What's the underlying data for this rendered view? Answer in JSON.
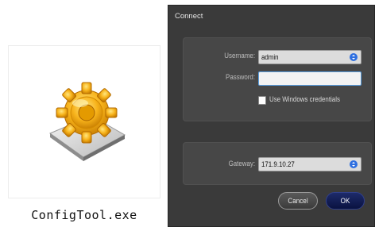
{
  "file": {
    "name": "ConfigTool.exe",
    "icon": "gear-on-tray-icon"
  },
  "dialog": {
    "title": "Connect",
    "username": {
      "label": "Username:",
      "value": "admin"
    },
    "password": {
      "label": "Password:",
      "value": ""
    },
    "windows_credentials": {
      "label": "Use Windows credentials",
      "checked": false
    },
    "gateway": {
      "label": "Gateway:",
      "value": "171.9.10.27"
    },
    "cancel_label": "Cancel",
    "ok_label": "OK"
  },
  "colors": {
    "dialog_bg": "#3a3a3a",
    "panel_bg": "#474747",
    "dropdown_accent": "#2e6fe0",
    "ok_button": "#0a1240"
  }
}
